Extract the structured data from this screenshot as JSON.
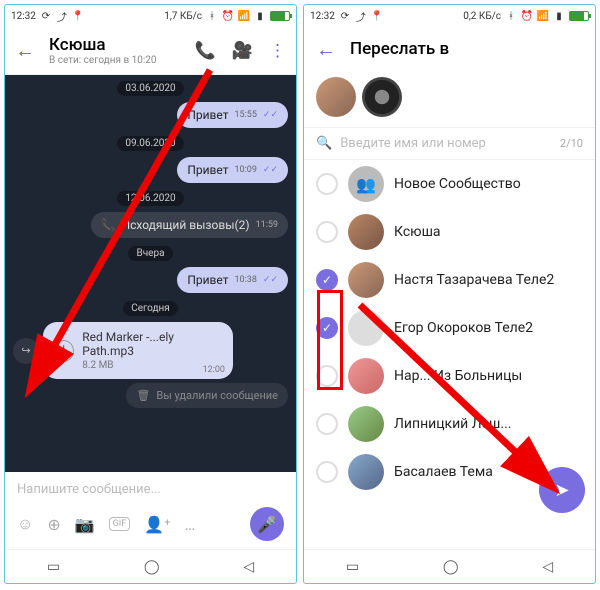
{
  "left": {
    "status": {
      "time": "12:32",
      "net": "1,7 КБ/с",
      "battery": "75"
    },
    "chat": {
      "name": "Ксюша",
      "presence": "В сети: сегодня в 10:20",
      "dates": {
        "d1": "03.06.2020",
        "d2": "09.06.2020",
        "d3": "12.06.2020",
        "d4": "Вчера",
        "d5": "Сегодня"
      },
      "msgs": {
        "m1": {
          "text": "Привет",
          "time": "15:55"
        },
        "m2": {
          "text": "Привет",
          "time": "10:09"
        },
        "call": {
          "text": "Исходящий вызовы(2)",
          "time": "11:59"
        },
        "m3": {
          "text": "Привет",
          "time": "10:38"
        },
        "file": {
          "name": "Red Marker -...ely Path.mp3",
          "size": "8.2 MB",
          "time": "12:00"
        },
        "deleted": "Вы удалили сообщение"
      },
      "compose_placeholder": "Напишите сообщение..."
    }
  },
  "right": {
    "status": {
      "time": "12:32",
      "net": "0,2 КБ/с",
      "battery": "75"
    },
    "title": "Переслать в",
    "search_placeholder": "Введите имя или номер",
    "selected_count": "2/10",
    "contacts": [
      {
        "name": "Новое Сообщество",
        "selected": false
      },
      {
        "name": "Ксюша",
        "selected": false
      },
      {
        "name": "Настя Тазарачева Теле2",
        "selected": true
      },
      {
        "name": "Егор Окороков Теле2",
        "selected": true
      },
      {
        "name": "Нар... Из Больницы",
        "selected": false
      },
      {
        "name": "Липницкий Леш...",
        "selected": false
      },
      {
        "name": "Басалаев Тема",
        "selected": false
      }
    ]
  }
}
